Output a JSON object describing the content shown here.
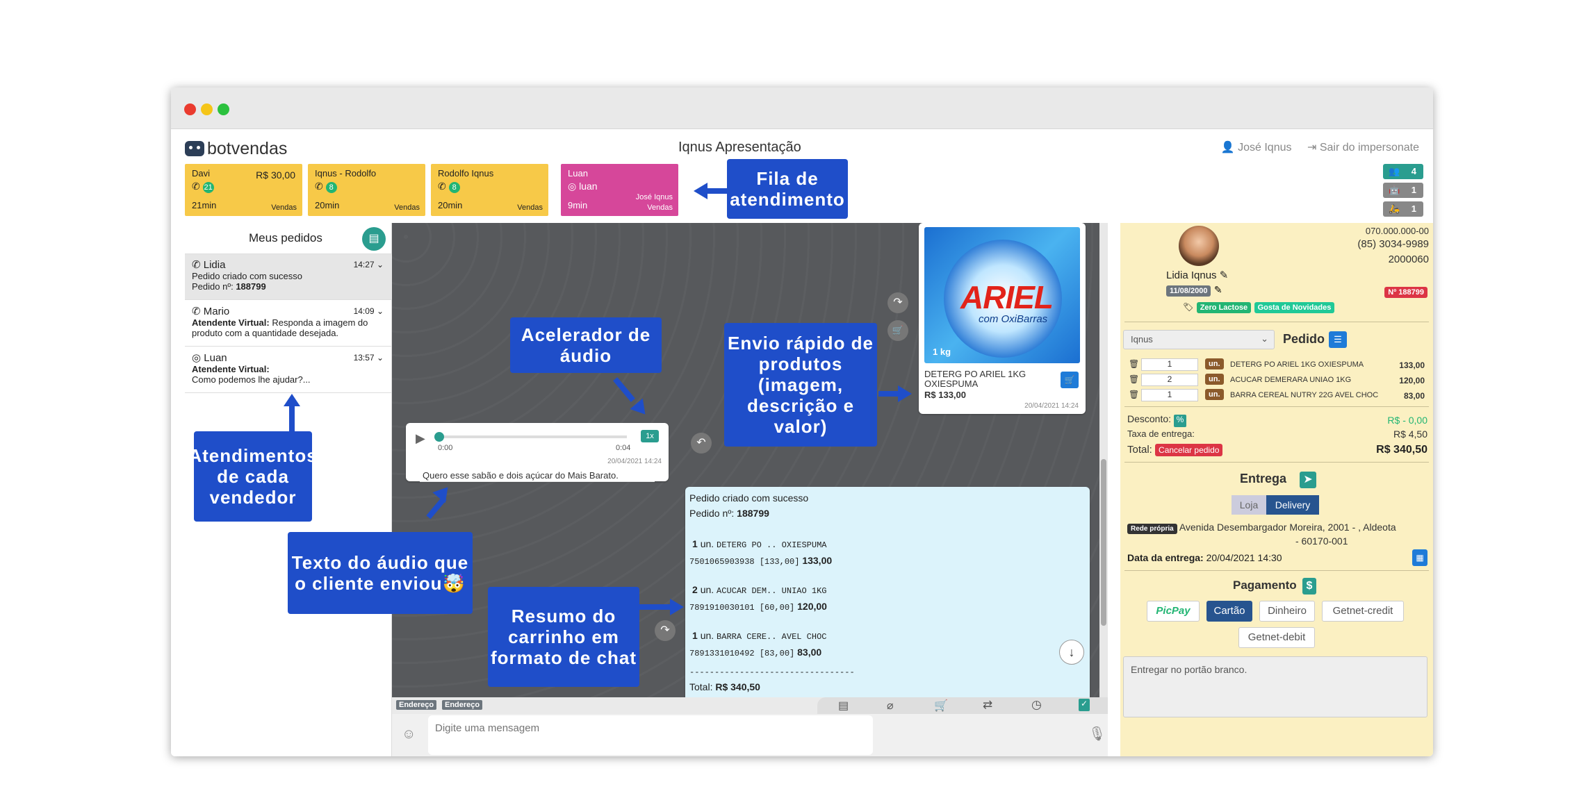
{
  "window": {
    "colors": {
      "close": "#ea3b2f",
      "min": "#f5c518",
      "max": "#2bc13e"
    }
  },
  "header": {
    "logo": "botvendas",
    "title": "Iqnus Apresentação",
    "user": "José Iqnus",
    "logout": "Sair do impersonate"
  },
  "queue": [
    {
      "name": "Davi",
      "value": "R$ 30,00",
      "count": "21",
      "time": "21min",
      "dept": "Vendas",
      "color": "#f7c948"
    },
    {
      "name": "Iqnus - Rodolfo",
      "value": "",
      "count": "8",
      "time": "20min",
      "dept": "Vendas",
      "color": "#f7c948"
    },
    {
      "name": "Rodolfo Iqnus",
      "value": "",
      "count": "8",
      "time": "20min",
      "dept": "Vendas",
      "color": "#f7c948"
    },
    {
      "name": "Luan",
      "value": "",
      "channel": "luan",
      "time": "9min",
      "agent": "José Iqnus",
      "dept": "Vendas",
      "color": "#d6479a"
    }
  ],
  "counters": [
    "4",
    "1",
    "1"
  ],
  "left": {
    "title": "Meus pedidos",
    "conversations": [
      {
        "name": "Lidia",
        "time": "14:27",
        "line1": "Pedido criado com sucesso",
        "line2_label": "Pedido nº:",
        "line2_value": "188799"
      },
      {
        "name": "Mario",
        "time": "14:09",
        "line1_label": "Atendente Virtual:",
        "line1": "Responda a imagem do",
        "line2": "produto com a quantidade desejada."
      },
      {
        "name": "Luan",
        "time": "13:57",
        "line1_label": "Atendente Virtual:",
        "line1": "Como podemos lhe ajudar?..."
      }
    ]
  },
  "annotations": {
    "fila": "Fila de atendimento",
    "acelerador": "Acelerador de áudio",
    "envio": "Envio rápido de produtos (imagem, descrição e valor)",
    "atendimentos": "Atendimentos de cada vendedor",
    "texto_audio": "Texto do áudio que o cliente enviou🤯",
    "resumo": "Resumo do carrinho em formato de chat"
  },
  "audio": {
    "start": "0:00",
    "end": "0:04",
    "speed": "1x",
    "timestamp": "20/04/2021 14:24",
    "transcript": "Quero esse sabão e dois açúcar do Mais Barato."
  },
  "product": {
    "brand": "ARIEL",
    "sub": "com OxiBarras",
    "weight": "1 kg",
    "desc1": "DETERG PO ARIEL 1KG",
    "desc2": "OXIESPUMA",
    "price": "R$ 133,00",
    "timestamp": "20/04/2021 14:24"
  },
  "summary": {
    "line1": "Pedido criado com sucesso",
    "order_label": "Pedido nº:",
    "order_value": "188799",
    "items": [
      {
        "qty": "1",
        "unit": "un.",
        "name": "DETERG PO .. OXIESPUMA",
        "code": "7501065903938 [133,00]",
        "total": "133,00"
      },
      {
        "qty": "2",
        "unit": "un.",
        "name": "ACUCAR DEM.. UNIAO 1KG",
        "code": "7891910030101 [60,00]",
        "total": "120,00"
      },
      {
        "qty": "1",
        "unit": "un.",
        "name": "BARRA CERE.. AVEL CHOC",
        "code": "7891331010492 [83,00]",
        "total": "83,00"
      }
    ],
    "divider": "---------------------------------",
    "total_label": "Total:",
    "total_value": "R$ 340,50"
  },
  "chat_tools": {
    "tag1": "Endereço",
    "tag2": "Endereço"
  },
  "input": {
    "placeholder": "Digite uma mensagem"
  },
  "customer": {
    "cpf": "070.000.000-00",
    "phone": "(85) 3034-9989",
    "code": "2000060",
    "name": "Lidia Iqnus",
    "birth": "11/08/2000",
    "order_badge": "Nº 188799",
    "tags": [
      "Zero Lactose",
      "Gosta de Novidades"
    ]
  },
  "order": {
    "store": "Iqnus",
    "title": "Pedido",
    "items": [
      {
        "qty": "1",
        "unit": "un.",
        "name": "DETERG PO ARIEL 1KG OXIESPUMA",
        "price": "133,00"
      },
      {
        "qty": "2",
        "unit": "un.",
        "name": "ACUCAR DEMERARA UNIAO 1KG",
        "price": "120,00"
      },
      {
        "qty": "1",
        "unit": "un.",
        "name": "BARRA CEREAL NUTRY 22G AVEL CHOC",
        "price": "83,00"
      }
    ],
    "discount_label": "Desconto:",
    "discount_value": "R$ - 0,00",
    "fee_label": "Taxa de entrega:",
    "fee_value": "R$ 4,50",
    "total_label": "Total:",
    "cancel": "Cancelar pedido",
    "total_value": "R$ 340,50"
  },
  "delivery": {
    "title": "Entrega",
    "opt1": "Loja",
    "opt2": "Delivery",
    "net": "Rede própria",
    "address1": "Avenida Desembargador Moreira, 2001 - , Aldeota",
    "address2": "- 60170-001",
    "date_label": "Data da entrega:",
    "date_value": "20/04/2021 14:30"
  },
  "payment": {
    "title": "Pagamento",
    "options": [
      "PicPay",
      "Cartão",
      "Dinheiro",
      "Getnet-credit",
      "Getnet-debit"
    ]
  },
  "notes": {
    "text": "Entregar no portão branco."
  }
}
